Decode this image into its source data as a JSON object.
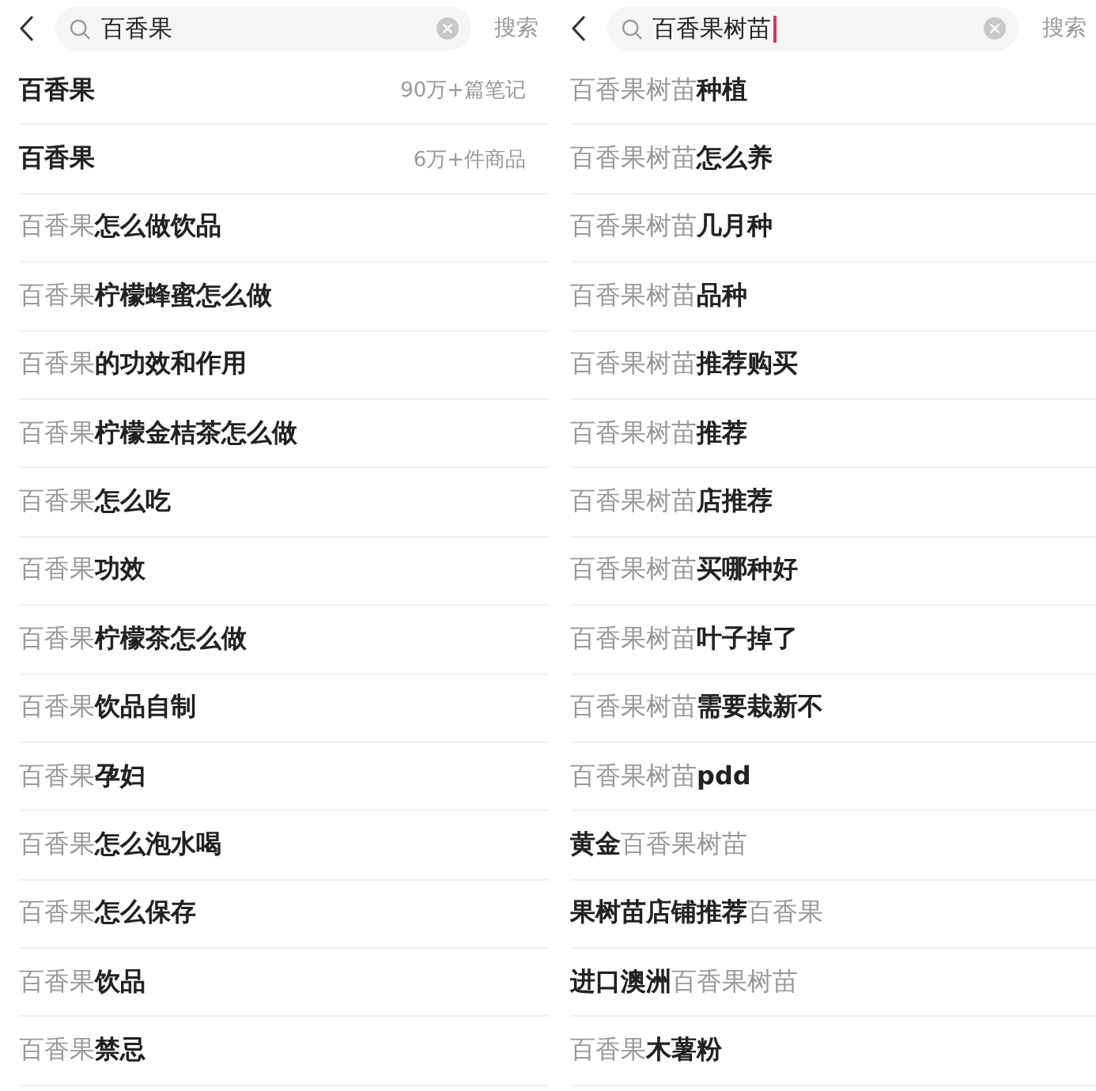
{
  "panels": [
    {
      "search": {
        "value": "百香果",
        "focused": false
      },
      "search_button": "搜索",
      "rows": [
        {
          "kind": "summary",
          "text": "百香果",
          "count": "90万+篇笔记"
        },
        {
          "kind": "summary",
          "text": "百香果",
          "count": "6万+件商品"
        },
        {
          "kind": "suggestion",
          "text": "百香果**怎么做饮品**"
        },
        {
          "kind": "suggestion",
          "text": "百香果**柠檬蜂蜜怎么做**"
        },
        {
          "kind": "suggestion",
          "text": "百香果**的功效和作用**"
        },
        {
          "kind": "suggestion",
          "text": "百香果**柠檬金桔茶怎么做**"
        },
        {
          "kind": "suggestion",
          "text": "百香果**怎么吃**"
        },
        {
          "kind": "suggestion",
          "text": "百香果**功效**"
        },
        {
          "kind": "suggestion",
          "text": "百香果**柠檬茶怎么做**"
        },
        {
          "kind": "suggestion",
          "text": "百香果**饮品自制**"
        },
        {
          "kind": "suggestion",
          "text": "百香果**孕妇**"
        },
        {
          "kind": "suggestion",
          "text": "百香果**怎么泡水喝**"
        },
        {
          "kind": "suggestion",
          "text": "百香果**怎么保存**"
        },
        {
          "kind": "suggestion",
          "text": "百香果**饮品**"
        },
        {
          "kind": "suggestion",
          "text": "百香果**禁忌**"
        }
      ]
    },
    {
      "search": {
        "value": "百香果树苗",
        "focused": true
      },
      "search_button": "搜索",
      "rows": [
        {
          "kind": "suggestion",
          "text": "百香果树苗**种植**"
        },
        {
          "kind": "suggestion",
          "text": "百香果树苗**怎么养**"
        },
        {
          "kind": "suggestion",
          "text": "百香果树苗**几月种**"
        },
        {
          "kind": "suggestion",
          "text": "百香果树苗**品种**"
        },
        {
          "kind": "suggestion",
          "text": "百香果树苗**推荐购买**"
        },
        {
          "kind": "suggestion",
          "text": "百香果树苗**推荐**"
        },
        {
          "kind": "suggestion",
          "text": "百香果树苗**店推荐**"
        },
        {
          "kind": "suggestion",
          "text": "百香果树苗**买哪种好**"
        },
        {
          "kind": "suggestion",
          "text": "百香果树苗**叶子掉了**"
        },
        {
          "kind": "suggestion",
          "text": "百香果树苗**需要栽新不**"
        },
        {
          "kind": "suggestion",
          "text": "百香果树苗**pdd**"
        },
        {
          "kind": "suggestion",
          "text": "**黄金**百香果树苗"
        },
        {
          "kind": "suggestion",
          "text": "**果树苗店铺推荐**百香果"
        },
        {
          "kind": "suggestion",
          "text": "**进口澳洲**百香果树苗"
        },
        {
          "kind": "suggestion",
          "text": "百香果**木薯粉**"
        }
      ]
    }
  ]
}
